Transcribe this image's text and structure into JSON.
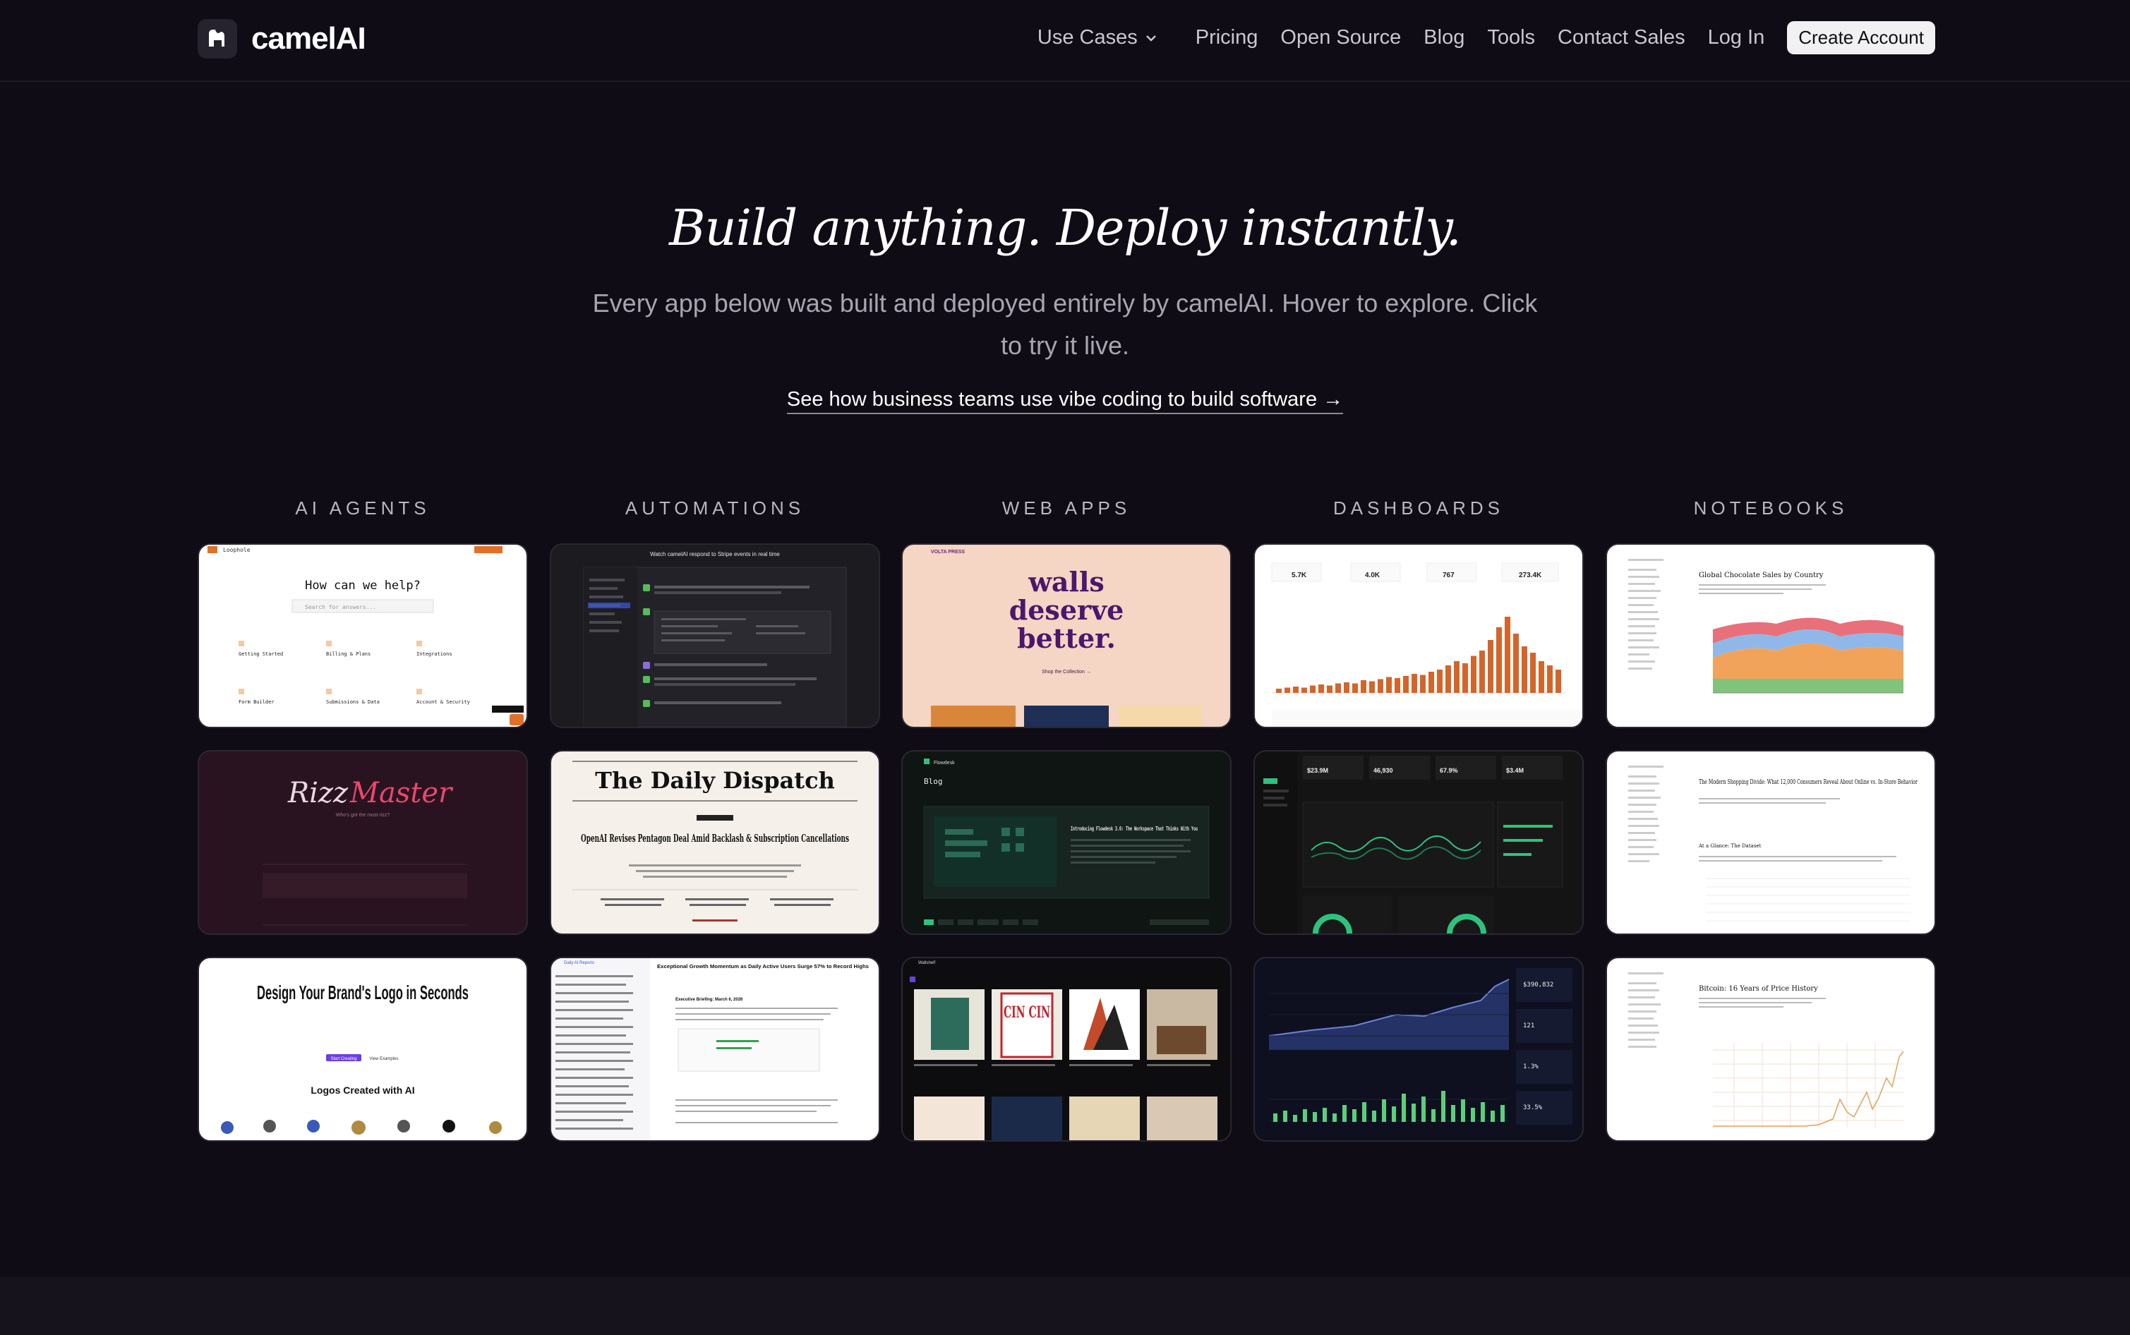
{
  "brand": {
    "name": "camelAI"
  },
  "nav": {
    "use_cases": "Use Cases",
    "pricing": "Pricing",
    "open_source": "Open Source",
    "blog": "Blog",
    "tools": "Tools",
    "contact_sales": "Contact Sales",
    "log_in": "Log In",
    "create_account": "Create Account"
  },
  "hero": {
    "title": "Build anything. Deploy instantly.",
    "subtitle": "Every app below was built and deployed entirely by camelAI. Hover to explore. Click to try it live.",
    "link": "See how business teams use vibe coding to build software →"
  },
  "categories": [
    "AI AGENTS",
    "AUTOMATIONS",
    "WEB APPS",
    "DASHBOARDS",
    "NOTEBOOKS"
  ],
  "cards": {
    "help_center": {
      "brand": "Loophole",
      "title": "How can we help?",
      "search": "Search for answers...",
      "topics": [
        "Getting Started",
        "Billing & Plans",
        "Integrations",
        "Form Builder",
        "Submissions & Data",
        "Account & Security"
      ]
    },
    "automation": {
      "title": "Watch camelAI respond to Stripe events in real time"
    },
    "volta": {
      "brand": "VOLTA PRESS",
      "headline": [
        "walls",
        "deserve",
        "better."
      ],
      "cta": "Shop the Collection →"
    },
    "dashboard1": {
      "stats": [
        "5.7K",
        "4.0K",
        "767",
        "273.4K"
      ]
    },
    "notebook1": {
      "title": "Global Chocolate Sales by Country"
    },
    "rizz": {
      "title_a": "Rizz",
      "title_b": "Master",
      "tagline": "Who's got the most rizz?"
    },
    "daily_dispatch": {
      "masthead": "The Daily Dispatch",
      "headline": "OpenAI Revises Pentagon Deal Amid Backlash & Subscription Cancellations"
    },
    "flowdesk": {
      "brand": "Flowdesk",
      "section": "Blog",
      "post": "Introducing Flowdesk 3.0: The Workspace That Thinks With You"
    },
    "dashboard2": {
      "stats": [
        "$23.9M",
        "46,930",
        "67.9%",
        "$3.4M"
      ]
    },
    "notebook2": {
      "title": "The Modern Shopping Divide: What 12,000 Consumers Reveal About Online vs. In-Store Behavior",
      "section": "At a Glance: The Dataset"
    },
    "logo_maker": {
      "headline": "Design Your Brand's Logo in Seconds",
      "primary": "Start Creating",
      "secondary": "View Examples",
      "footer": "Logos Created with AI"
    },
    "daily_reports": {
      "brand": "Daily AI Reports",
      "headline": "Exceptional Growth Momentum as Daily Active Users Surge 57% to Record Highs",
      "section": "Executive Briefing: March 6, 2026"
    },
    "wallshop": {
      "brand": "Wallshelf",
      "poster": "CIN CIN"
    },
    "dashboard3": {
      "stats": [
        "$390,832",
        "121",
        "1.3%",
        "33.5%"
      ]
    },
    "notebook3": {
      "title": "Bitcoin: 16 Years of Price History"
    }
  }
}
